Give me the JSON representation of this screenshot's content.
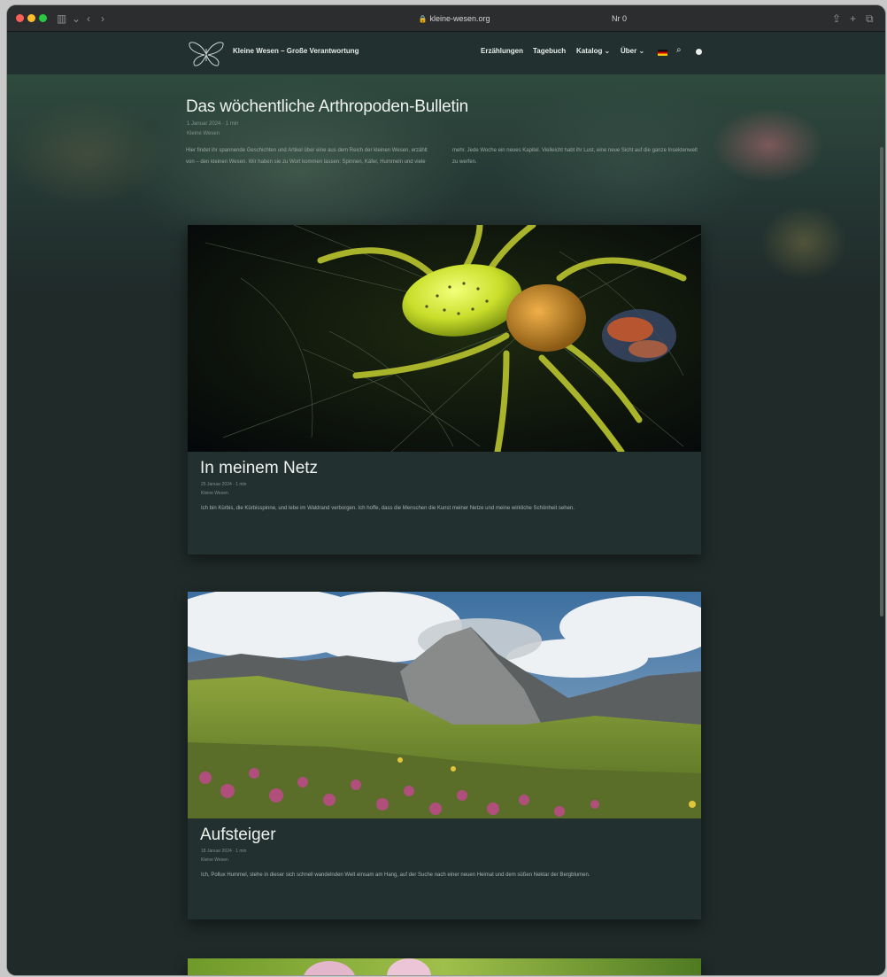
{
  "browser": {
    "url": "kleine-wesen.org",
    "reader_label": "Nr 0",
    "icons": [
      "sidebar-icon",
      "back-icon",
      "forward-icon",
      "share-icon",
      "new-tab-icon",
      "tabs-icon"
    ]
  },
  "nav": {
    "site_title": "Kleine Wesen – Große Verantwortung",
    "items": [
      "Erzählungen",
      "Tagebuch",
      "Katalog ⌄",
      "Über ⌄"
    ],
    "language_flag": "de"
  },
  "bulletin": {
    "title": "Das wöchentliche Arthropoden-Bulletin",
    "meta": "1 Januar 2024 · 1 min",
    "subline": "Kleine Wesen",
    "intro": "Hier findet ihr spannende Geschichten und Artikel über eine aus dem Reich der kleinen Wesen, erzählt von – den kleinen Wesen. Wir haben sie zu Wort kommen lassen: Spinnen, Käfer, Hummeln und viele mehr. Jede Woche ein neues Kapitel. Vielleicht habt ihr Lust, eine neue Sicht auf die ganze Insektenwelt zu werfen."
  },
  "posts": [
    {
      "title": "In meinem Netz",
      "meta": "25 Januar 2024 · 1 min",
      "subline": "Kleine Wesen",
      "excerpt": "Ich bin Kürbis, die Kürbisspinne, und lebe im Waldrand verborgen. Ich hoffe, dass die Menschen die Kunst meiner Netze und meine wirkliche Schönheit sehen."
    },
    {
      "title": "Aufsteiger",
      "meta": "18 Januar 2024 · 1 min",
      "subline": "Kleine Wesen",
      "excerpt": "Ich, Pollux Hummel, stehe in dieser sich schnell wandelnden Welt einsam am Hang, auf der Suche nach einer neuen Heimat und dem süßen Nektar der Bergblumen."
    }
  ],
  "colors": {
    "background": "#1f2a29",
    "card": "#233030",
    "text": "#eef2ef",
    "muted": "#7d928a"
  }
}
